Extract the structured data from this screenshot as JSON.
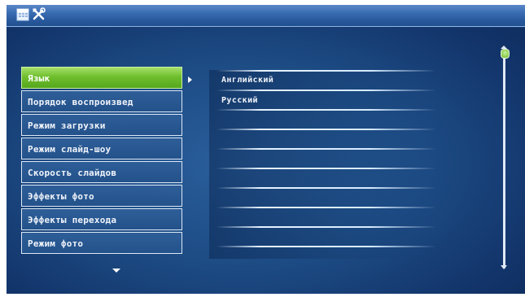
{
  "menu": {
    "items": [
      {
        "label": "Язык",
        "selected": true
      },
      {
        "label": "Порядок воспроизвед",
        "selected": false
      },
      {
        "label": "Режим загрузки",
        "selected": false
      },
      {
        "label": "Режим слайд-шоу",
        "selected": false
      },
      {
        "label": "Скорость слайдов",
        "selected": false
      },
      {
        "label": "Эффекты фото",
        "selected": false
      },
      {
        "label": "Эффекты перехода",
        "selected": false
      },
      {
        "label": "Режим фото",
        "selected": false
      }
    ]
  },
  "options": {
    "items": [
      "Английский",
      "Русский"
    ],
    "selected_index": 0
  },
  "icons": {
    "top_left": [
      "calendar-icon",
      "tools-icon"
    ]
  },
  "colors": {
    "background": "#1d4b84",
    "selected": "#6fbf2e",
    "text": "#f0f4fa"
  }
}
